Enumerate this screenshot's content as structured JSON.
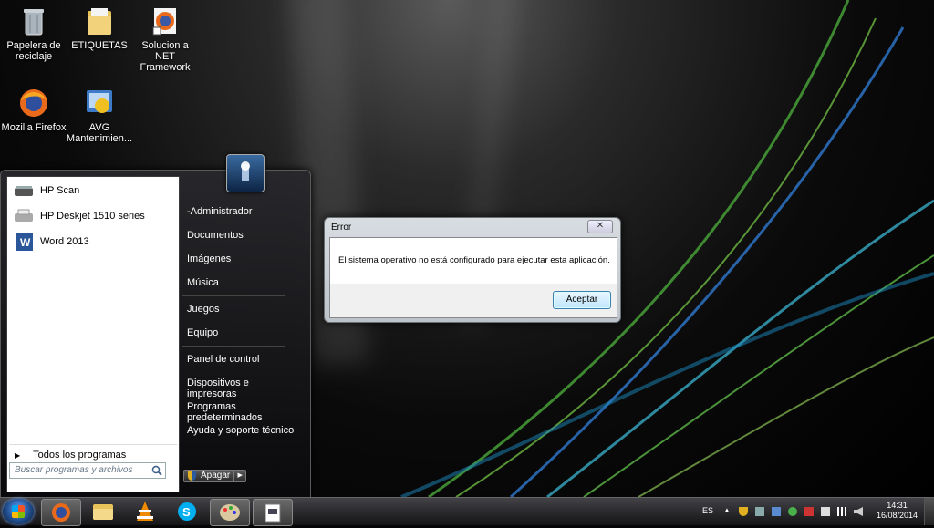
{
  "desktop": {
    "icons": [
      {
        "label": "Papelera de reciclaje",
        "icon": "recycle-bin-icon"
      },
      {
        "label": "ETIQUETAS",
        "icon": "folder-icon"
      },
      {
        "label": "Solucion a NET Framework",
        "icon": "firefox-shortcut-icon"
      },
      {
        "label": "Mozilla Firefox",
        "icon": "firefox-icon"
      },
      {
        "label": "AVG Mantenimien...",
        "icon": "avg-icon"
      }
    ]
  },
  "start_menu": {
    "programs": [
      {
        "label": "HP Scan",
        "icon": "scanner-icon"
      },
      {
        "label": "HP Deskjet 1510 series",
        "icon": "printer-icon"
      },
      {
        "label": "Word 2013",
        "icon": "word-icon"
      }
    ],
    "all_programs": "Todos los programas",
    "search_placeholder": "Buscar programas y archivos",
    "right_items": [
      "-Administrador",
      "Documentos",
      "Imágenes",
      "Música",
      "Juegos",
      "Equipo",
      "Panel de control",
      "Dispositivos e impresoras",
      "Programas predeterminados",
      "Ayuda y soporte técnico"
    ],
    "shutdown_label": "Apagar"
  },
  "dialog": {
    "title": "Error",
    "close": "✕",
    "message": "El sistema operativo no está configurado para ejecutar esta aplicación.",
    "button": "Aceptar"
  },
  "taskbar": {
    "apps": [
      "firefox-icon",
      "explorer-icon",
      "vlc-icon",
      "skype-icon",
      "paint-icon",
      "document-icon"
    ],
    "language": "ES",
    "time": "14:31",
    "date": "16/08/2014"
  }
}
